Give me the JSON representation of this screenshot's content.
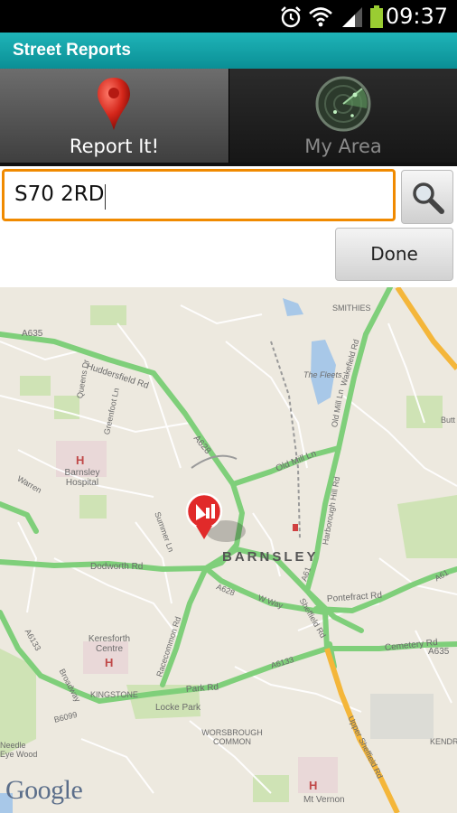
{
  "status_bar": {
    "time": "09:37"
  },
  "app": {
    "title": "Street Reports"
  },
  "tabs": [
    {
      "label": "Report It!",
      "icon": "map-pin-icon",
      "active": true
    },
    {
      "label": "My Area",
      "icon": "radar-icon",
      "active": false
    }
  ],
  "search": {
    "value": "S70 2RD",
    "button_icon": "search-icon"
  },
  "done_button": {
    "label": "Done"
  },
  "map": {
    "town": "BARNSLEY",
    "logo": "Google",
    "places": [
      "Barnsley Hospital",
      "Keresforth Centre",
      "Locke Park",
      "Worsbrough Common",
      "Mt Vernon",
      "Smithies",
      "The Fleets",
      "Kingstone",
      "Needle Eye Wood",
      "Kendr"
    ],
    "roads": [
      "A635",
      "Huddersfield Rd",
      "Gr...",
      "Queens Dr",
      "Greenfoot Ln",
      "A628",
      "Old Mill Ln",
      "Harborough Hill Rd",
      "Wakefield Rd",
      "Old Mill Ln",
      "Dodworth Rd",
      "Summer Ln",
      "Pontefract Rd",
      "W Way",
      "Sheffield Rd",
      "A61",
      "A628",
      "Racecommon Rd",
      "Cemetery Rd",
      "A6133",
      "Park Rd",
      "Broadway",
      "B6099",
      "A6133",
      "A635",
      "Upper Sheffield Rd",
      "Warren",
      "Butt",
      "A61"
    ]
  }
}
